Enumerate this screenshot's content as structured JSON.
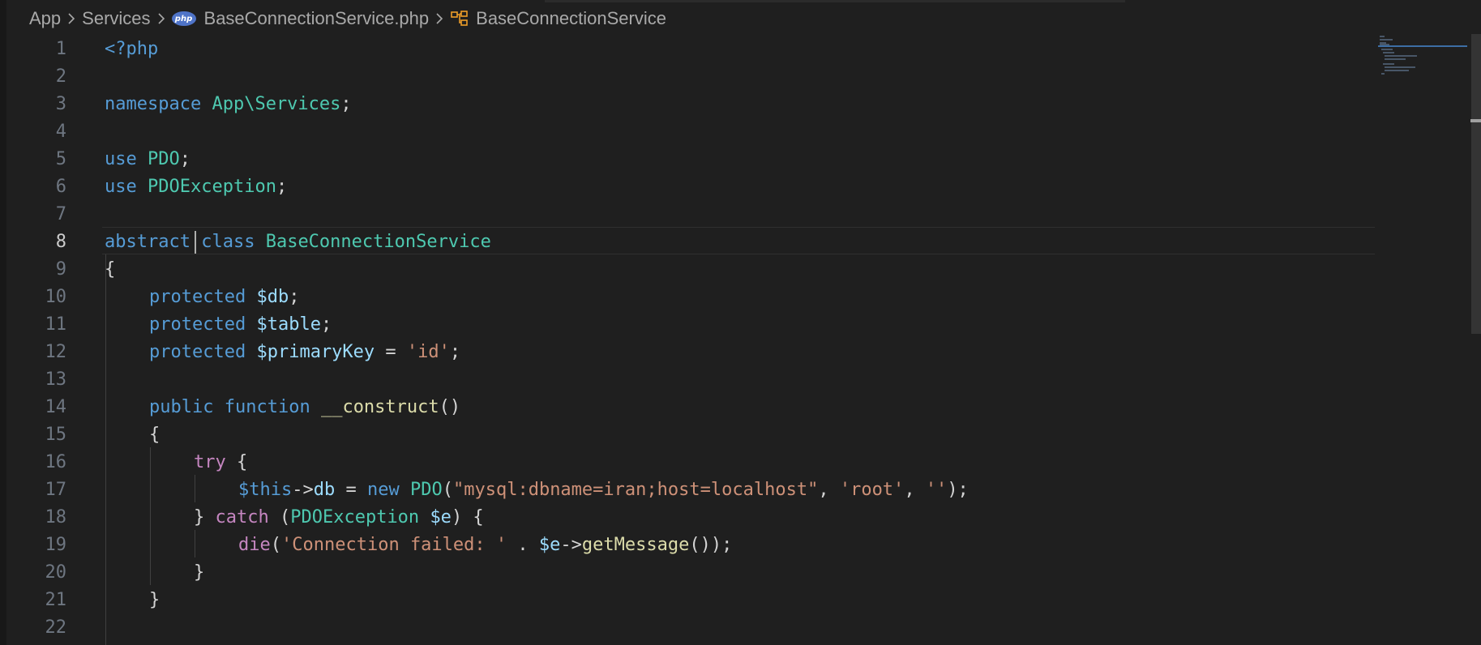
{
  "breadcrumb": {
    "items": [
      "App",
      "Services",
      "BaseConnectionService.php",
      "BaseConnectionService"
    ],
    "php_badge": "php"
  },
  "editor": {
    "active_line": 8,
    "line_numbers": [
      "1",
      "2",
      "3",
      "4",
      "5",
      "6",
      "7",
      "8",
      "9",
      "10",
      "11",
      "12",
      "13",
      "14",
      "15",
      "16",
      "17",
      "18",
      "19",
      "20",
      "21",
      "22"
    ]
  },
  "code": {
    "l1": [
      "<?php"
    ],
    "l3": [
      "namespace",
      " ",
      "App\\Services",
      ";"
    ],
    "l5": [
      "use",
      " ",
      "PDO",
      ";"
    ],
    "l6": [
      "use",
      " ",
      "PDOException",
      ";"
    ],
    "l8": [
      "abstract",
      " ",
      "class",
      " ",
      "BaseConnectionService"
    ],
    "l9": [
      "{"
    ],
    "l10": [
      "protected",
      " ",
      "$db",
      ";"
    ],
    "l11": [
      "protected",
      " ",
      "$table",
      ";"
    ],
    "l12": [
      "protected",
      " ",
      "$primaryKey",
      " = ",
      "'id'",
      ";"
    ],
    "l14": [
      "public",
      " ",
      "function",
      " ",
      "__construct",
      "()"
    ],
    "l15": [
      "{"
    ],
    "l16": [
      "try",
      " {"
    ],
    "l17": [
      "$this",
      "->",
      "db",
      " = ",
      "new",
      " ",
      "PDO",
      "(",
      "\"mysql:dbname=iran;host=localhost\"",
      ", ",
      "'root'",
      ", ",
      "''",
      ");"
    ],
    "l18": [
      "} ",
      "catch",
      " (",
      "PDOException",
      " ",
      "$e",
      ") {"
    ],
    "l19": [
      "die",
      "(",
      "'Connection failed: '",
      " . ",
      "$e",
      "->",
      "getMessage",
      "());"
    ],
    "l20": [
      "}"
    ],
    "l21": [
      "}"
    ]
  },
  "colors": {
    "background": "#1f1f1f",
    "keyword": "#569cd6",
    "control": "#c586c0",
    "class": "#4ec9b0",
    "variable": "#9cdcfe",
    "string": "#ce9178",
    "function": "#dcdcaa",
    "plain": "#d4d4d4",
    "line_number": "#6e7681"
  },
  "icons": {
    "breadcrumb_separator": "chevron-right-icon",
    "file_type": "php-icon",
    "symbol": "class-symbol-icon"
  }
}
